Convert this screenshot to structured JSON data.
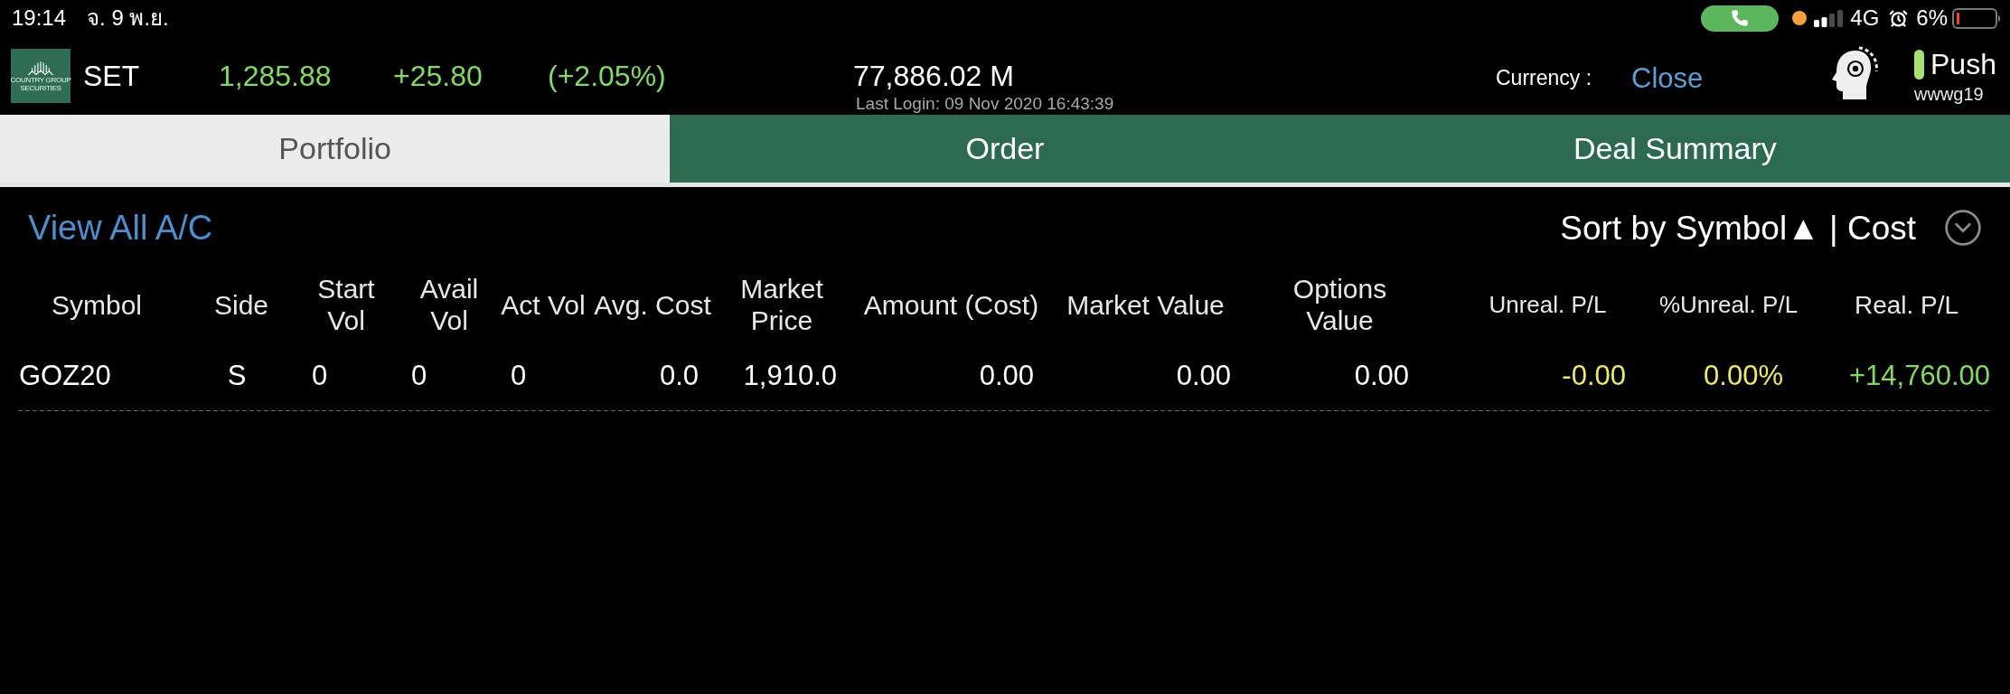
{
  "status_bar": {
    "time": "19:14",
    "date": "จ. 9 พ.ย.",
    "network": "4G",
    "battery": "6%"
  },
  "header": {
    "logo": {
      "lines": [
        "COUNTRY GROUP",
        "SECURITIES"
      ]
    },
    "index": {
      "name": "SET",
      "value": "1,285.88",
      "change": "+25.80",
      "percent": "(+2.05%)",
      "color": "#80dc5c"
    },
    "turnover": "77,886.02 M",
    "last_login": "Last Login: 09 Nov 2020 16:43:39",
    "currency_label": "Currency :",
    "currency_value": "Close",
    "push": {
      "label": "Push",
      "connected": true
    },
    "user": "wwwg19"
  },
  "tabs": [
    {
      "label": "Portfolio",
      "selected": true
    },
    {
      "label": "Order",
      "selected": false
    },
    {
      "label": "Deal Summary",
      "selected": false
    }
  ],
  "account_link": "View All A/C",
  "sort": {
    "label": "Sort by Symbol▲ | Cost"
  },
  "table": {
    "columns": [
      {
        "lines": [
          "Symbol"
        ]
      },
      {
        "lines": [
          "Side"
        ]
      },
      {
        "lines": [
          "Start",
          "Vol"
        ]
      },
      {
        "lines": [
          "Avail",
          "Vol"
        ]
      },
      {
        "lines": [
          "Act Vol"
        ]
      },
      {
        "lines": [
          "Avg. Cost"
        ]
      },
      {
        "lines": [
          "Market",
          "Price"
        ]
      },
      {
        "lines": [
          "Amount (Cost)"
        ]
      },
      {
        "lines": [
          "Market Value"
        ]
      },
      {
        "lines": [
          "Options",
          "Value"
        ]
      },
      {
        "lines": [
          "Unreal. P/L"
        ]
      },
      {
        "lines": [
          "%Unreal. P/L"
        ]
      },
      {
        "lines": [
          "Real. P/L"
        ]
      }
    ],
    "rows": [
      {
        "cells": [
          {
            "text": "GOZ20"
          },
          {
            "text": "S"
          },
          {
            "text": "0"
          },
          {
            "text": "0"
          },
          {
            "text": "0"
          },
          {
            "text": "0.0"
          },
          {
            "text": "1,910.0"
          },
          {
            "text": "0.00"
          },
          {
            "text": "0.00"
          },
          {
            "text": "0.00"
          },
          {
            "text": "-0.00",
            "color": "#ecec5c"
          },
          {
            "text": "0.00%",
            "color": "#ecec5c"
          },
          {
            "text": "+14,760.00",
            "color": "#80dc5c"
          }
        ]
      }
    ]
  }
}
